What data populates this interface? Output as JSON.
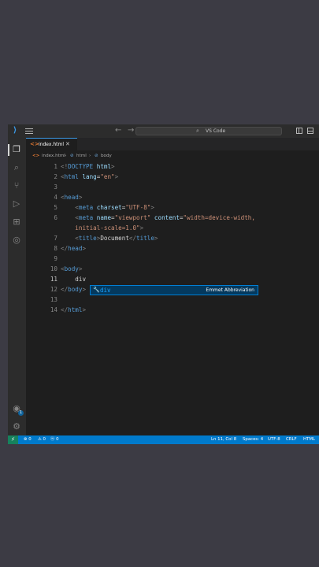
{
  "titlebar": {
    "search_text": "VS Code",
    "back_glyph": "←",
    "forward_glyph": "→"
  },
  "tab": {
    "label": "index.html",
    "close": "✕",
    "icon": "<>"
  },
  "breadcrumb": {
    "file": "index.html",
    "sep": "›",
    "html": "html",
    "body": "body"
  },
  "editor": {
    "lines": [
      {
        "n": "1"
      },
      {
        "n": "2"
      },
      {
        "n": "3"
      },
      {
        "n": "4"
      },
      {
        "n": "5"
      },
      {
        "n": "6"
      },
      {
        "n": "7"
      },
      {
        "n": "8"
      },
      {
        "n": "9"
      },
      {
        "n": "10"
      },
      {
        "n": "11"
      },
      {
        "n": "12"
      },
      {
        "n": "13"
      },
      {
        "n": "14"
      }
    ]
  },
  "code": {
    "l1_open": "<!",
    "l1_tag": "DOCTYPE",
    "l1_attr": "html",
    "l1_close": ">",
    "l2_tag": "html",
    "l2_attr": "lang",
    "l2_val": "\"en\"",
    "l4_tag": "head",
    "l5_tag": "meta",
    "l5_attr": "charset",
    "l5_val": "\"UTF-8\"",
    "l6_tag": "meta",
    "l6_attr1": "name",
    "l6_val1": "\"viewport\"",
    "l6_attr2": "content",
    "l6_val2a": "\"width=device-width,",
    "l6_val2b": "initial-scale=1.0\"",
    "l7_tag": "title",
    "l7_text": "Document",
    "l8_tag": "head",
    "l10_tag": "body",
    "l11_text": "div",
    "l12_tag": "body",
    "l14_tag": "html"
  },
  "suggest": {
    "icon": "🔧",
    "match": "div",
    "detail": "Emmet Abbreviation"
  },
  "statusbar": {
    "remote": "⚡",
    "errors": "⊗ 0",
    "warnings": "⚠ 0",
    "ports": "ⓦ 0",
    "position": "Ln 11, Col 8",
    "spaces": "Spaces: 4",
    "encoding": "UTF-8",
    "eol": "CRLF",
    "language": "HTML"
  },
  "colors": {
    "accent": "#007acc",
    "tag": "#569cd6",
    "attr": "#9cdcfe",
    "string": "#ce9178"
  }
}
